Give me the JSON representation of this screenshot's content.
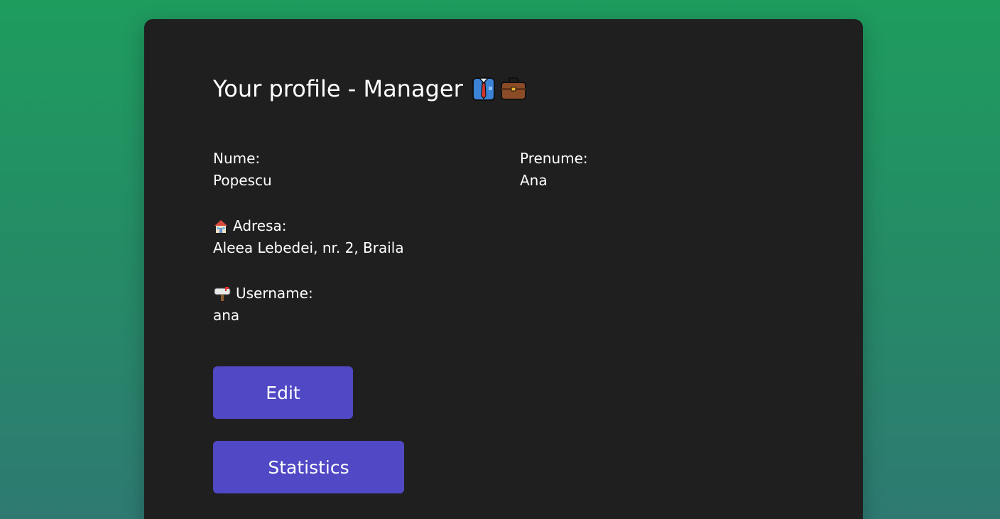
{
  "profile": {
    "title": "Your profile - Manager",
    "title_icons": [
      "shirt-tie-icon",
      "briefcase-icon"
    ],
    "fields": {
      "nume": {
        "label": "Nume:",
        "value": "Popescu"
      },
      "prenume": {
        "label": "Prenume:",
        "value": "Ana"
      },
      "adresa": {
        "label": "Adresa:",
        "value": "Aleea Lebedei, nr. 2, Braila",
        "icon": "house-icon"
      },
      "username": {
        "label": "Username:",
        "value": "ana",
        "icon": "mailbox-icon"
      }
    }
  },
  "actions": {
    "edit_label": "Edit",
    "statistics_label": "Statistics"
  },
  "colors": {
    "background_top": "#1e9c5e",
    "background_bottom": "#2e7a72",
    "card": "#1f1f1f",
    "button": "#5048c4",
    "text": "#ffffff"
  }
}
